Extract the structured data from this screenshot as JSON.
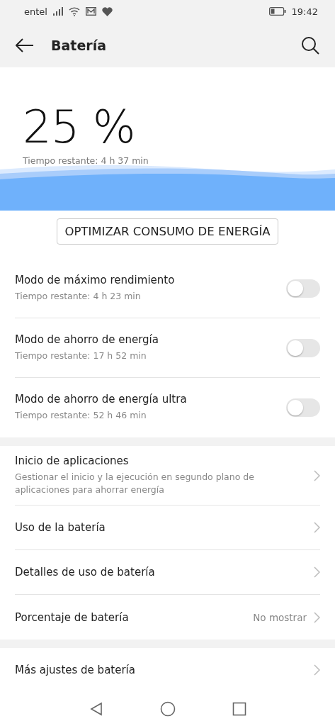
{
  "status_bar": {
    "carrier": "entel",
    "time": "19:42"
  },
  "app_bar": {
    "title": "Batería"
  },
  "battery": {
    "percent": "25 %",
    "remaining": "Tiempo restante: 4 h 37 min"
  },
  "optimize_button": "OPTIMIZAR CONSUMO DE ENERGÍA",
  "modes": [
    {
      "title": "Modo de máximo rendimiento",
      "subtitle": "Tiempo restante: 4 h 23 min",
      "on": false
    },
    {
      "title": "Modo de ahorro de energía",
      "subtitle": "Tiempo restante: 17 h 52 min",
      "on": false
    },
    {
      "title": "Modo de ahorro de energía ultra",
      "subtitle": "Tiempo restante: 52 h 46 min",
      "on": false
    }
  ],
  "settings": [
    {
      "title": "Inicio de aplicaciones",
      "subtitle": "Gestionar el inicio y la ejecución en segundo plano de aplicaciones para ahorrar energía"
    },
    {
      "title": "Uso de la batería"
    },
    {
      "title": "Detalles de uso de batería"
    },
    {
      "title": "Porcentaje de batería",
      "value": "No mostrar"
    }
  ],
  "more_settings": [
    {
      "title": "Más ajustes de batería"
    }
  ]
}
